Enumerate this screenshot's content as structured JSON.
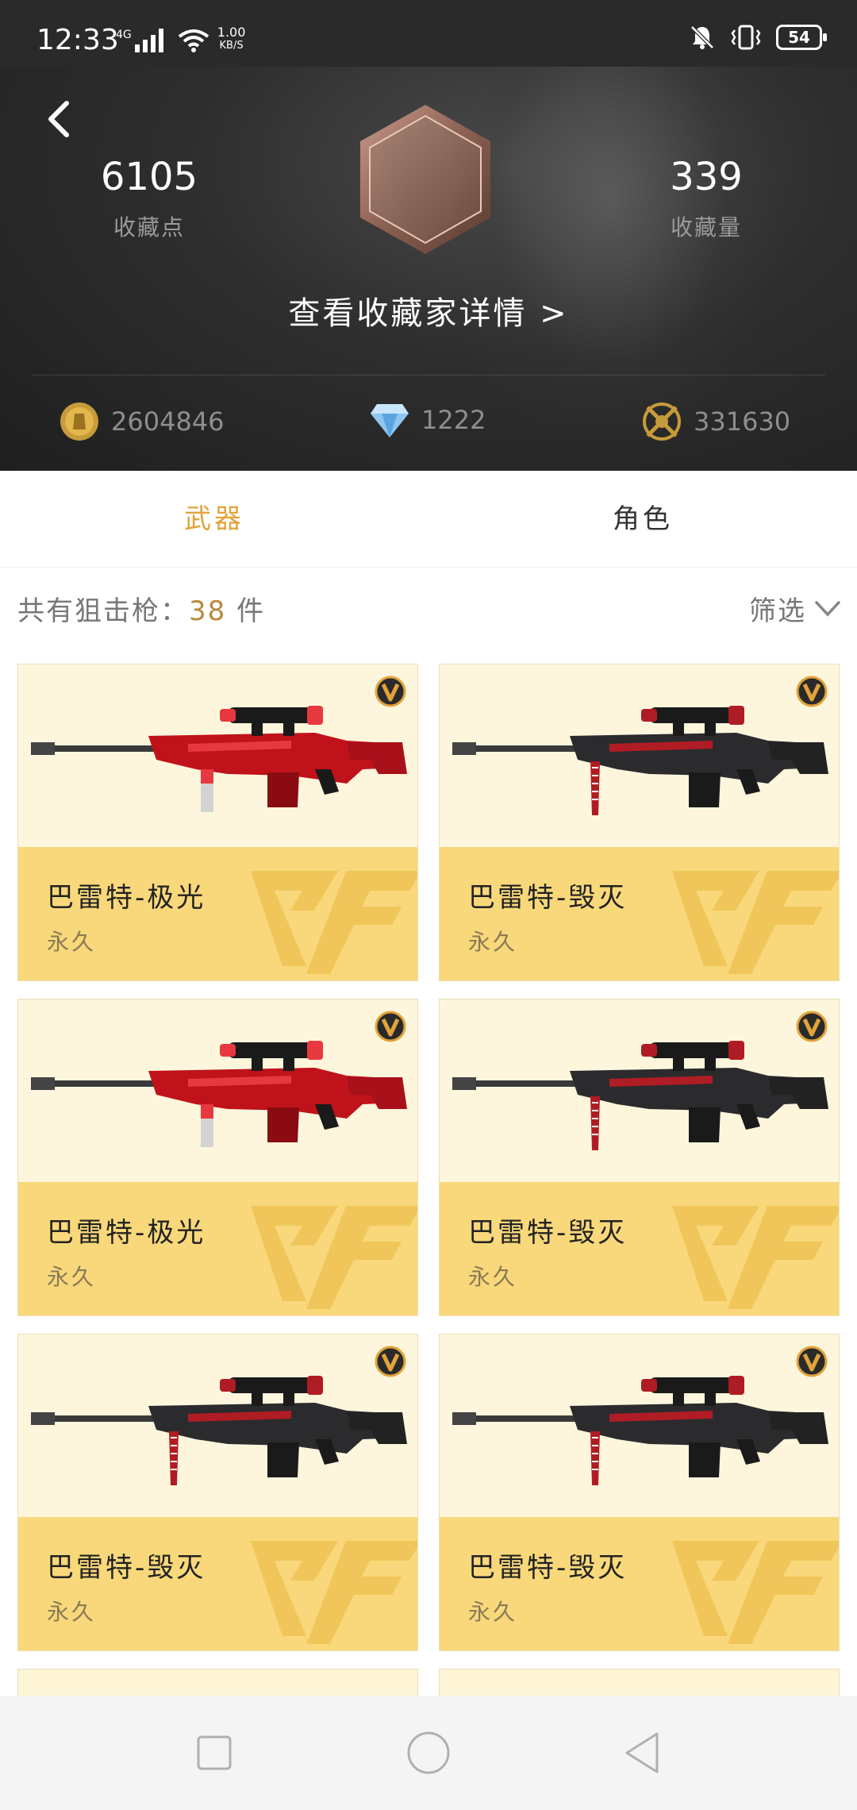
{
  "status_bar": {
    "time": "12:33",
    "network": "4G",
    "speed_value": "1.00",
    "speed_unit": "KB/S",
    "battery": "54"
  },
  "profile": {
    "collection_points_value": "6105",
    "collection_points_label": "收藏点",
    "collection_count_value": "339",
    "collection_count_label": "收藏量",
    "details_link": "查看收藏家详情 >"
  },
  "currencies": {
    "gold": "2604846",
    "diamond": "1222",
    "ticket": "331630"
  },
  "tabs": [
    {
      "label": "武器",
      "active": true
    },
    {
      "label": "角色",
      "active": false
    }
  ],
  "summary": {
    "prefix": "共有狙击枪：",
    "count": "38",
    "suffix": " 件",
    "filter_label": "筛选"
  },
  "items": [
    {
      "name": "巴雷特-极光",
      "duration": "永久",
      "variant": "red"
    },
    {
      "name": "巴雷特-毁灭",
      "duration": "永久",
      "variant": "dark"
    },
    {
      "name": "巴雷特-极光",
      "duration": "永久",
      "variant": "red"
    },
    {
      "name": "巴雷特-毁灭",
      "duration": "永久",
      "variant": "dark"
    },
    {
      "name": "巴雷特-毁灭",
      "duration": "永久",
      "variant": "dark"
    },
    {
      "name": "巴雷特-毁灭",
      "duration": "永久",
      "variant": "dark"
    }
  ],
  "colors": {
    "accent": "#e2a33a",
    "card_bottom": "#f8d87a",
    "card_top": "#fdf6dc",
    "header_bg": "#2e2e2e"
  }
}
